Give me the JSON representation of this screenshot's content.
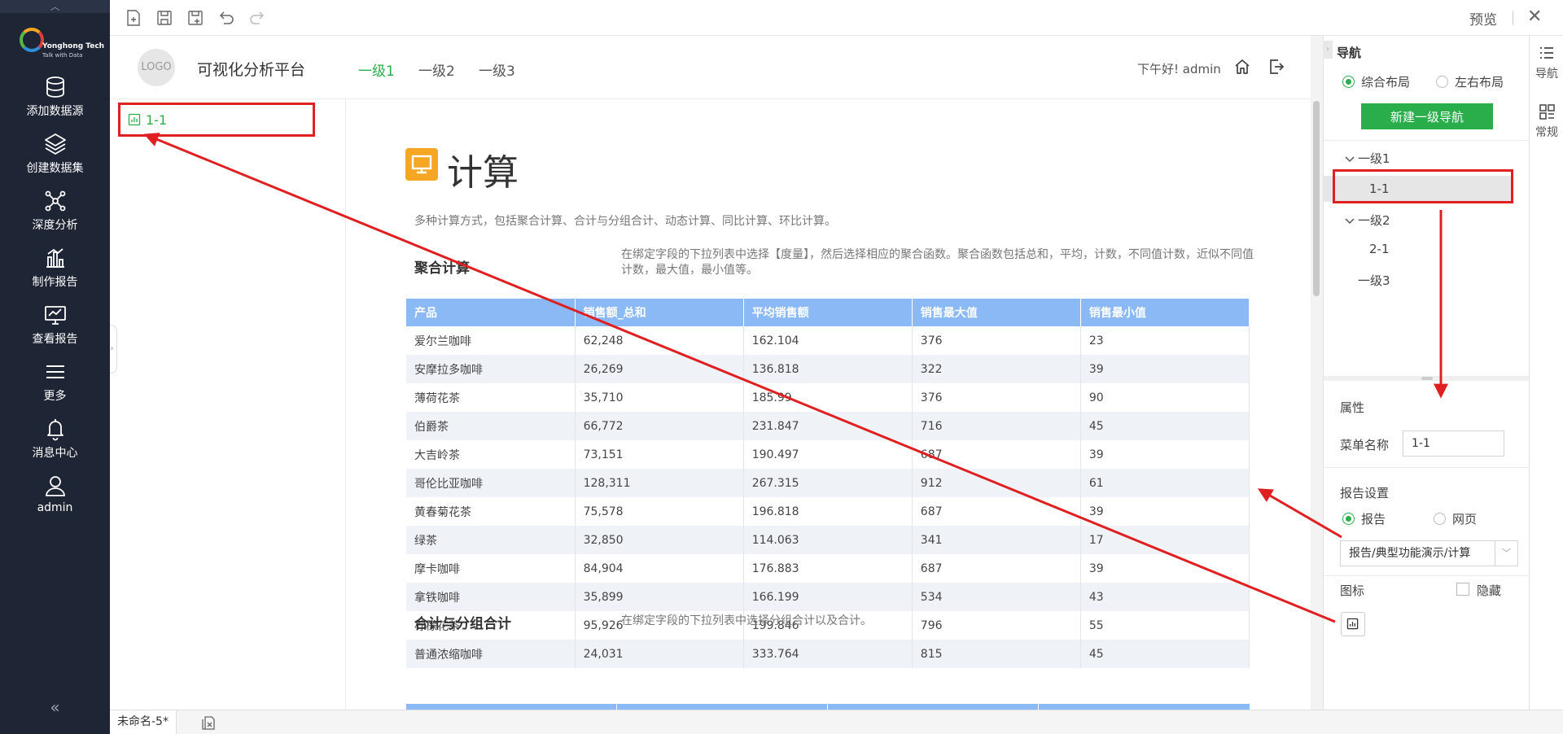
{
  "sidebar": {
    "brand": {
      "name": "Yonghong Tech",
      "slogan": "Talk with Data"
    },
    "items": [
      {
        "label": "添加数据源",
        "icon": "database-icon"
      },
      {
        "label": "创建数据集",
        "icon": "layers-icon"
      },
      {
        "label": "深度分析",
        "icon": "network-icon"
      },
      {
        "label": "制作报告",
        "icon": "bar-chart-icon"
      },
      {
        "label": "查看报告",
        "icon": "monitor-chart-icon"
      },
      {
        "label": "更多",
        "icon": "menu-icon"
      },
      {
        "label": "消息中心",
        "icon": "bell-icon"
      },
      {
        "label": "admin",
        "icon": "user-icon"
      }
    ]
  },
  "toolbar": {
    "preview_label": "预览",
    "close_label": "✕"
  },
  "app_header": {
    "logo_text": "LOGO",
    "title": "可视化分析平台",
    "nav": [
      "一级1",
      "一级2",
      "一级3"
    ],
    "active_nav": "一级1",
    "greeting": "下午好! admin"
  },
  "left_menu": {
    "item": "1-1"
  },
  "report": {
    "title": "计算",
    "description": "多种计算方式，包括聚合计算、合计与分组合计、动态计算、同比计算、环比计算。",
    "section1": {
      "title": "聚合计算",
      "description": "在绑定字段的下拉列表中选择【度量】，然后选择相应的聚合函数。聚合函数包括总和，平均，计数，不同值计数，近似不同值计数，最大值，最小值等。"
    },
    "table": {
      "headers": [
        "产品",
        "销售额_总和",
        "平均销售额",
        "销售最大值",
        "销售最小值"
      ],
      "rows": [
        [
          "爱尔兰咖啡",
          "62,248",
          "162.104",
          "376",
          "23"
        ],
        [
          "安摩拉多咖啡",
          "26,269",
          "136.818",
          "322",
          "39"
        ],
        [
          "薄荷花茶",
          "35,710",
          "185.99",
          "376",
          "90"
        ],
        [
          "伯爵茶",
          "66,772",
          "231.847",
          "716",
          "45"
        ],
        [
          "大吉岭茶",
          "73,151",
          "190.497",
          "687",
          "39"
        ],
        [
          "哥伦比亚咖啡",
          "128,311",
          "267.315",
          "912",
          "61"
        ],
        [
          "黄春菊花茶",
          "75,578",
          "196.818",
          "687",
          "39"
        ],
        [
          "绿茶",
          "32,850",
          "114.063",
          "341",
          "17"
        ],
        [
          "摩卡咖啡",
          "84,904",
          "176.883",
          "687",
          "39"
        ],
        [
          "拿铁咖啡",
          "35,899",
          "166.199",
          "534",
          "43"
        ],
        [
          "柠檬花茶",
          "95,926",
          "199.846",
          "796",
          "55"
        ],
        [
          "普通浓缩咖啡",
          "24,031",
          "333.764",
          "815",
          "45"
        ]
      ]
    },
    "section2": {
      "title": "合计与分组合计",
      "description": "在绑定字段的下拉列表中选择分组合计以及合计。"
    }
  },
  "bottom_tab": {
    "label": "未命名-5*"
  },
  "right_panel": {
    "nav_title": "导航",
    "layout_options": [
      "综合布局",
      "左右布局"
    ],
    "layout_selected": "综合布局",
    "new_button": "新建一级导航",
    "tree": [
      {
        "label": "一级1",
        "children": [
          "1-1"
        ]
      },
      {
        "label": "一级2",
        "children": [
          "2-1"
        ]
      },
      {
        "label": "一级3",
        "children": []
      }
    ],
    "selected_node": "1-1",
    "properties_title": "属性",
    "menu_name_label": "菜单名称",
    "menu_name_value": "1-1",
    "report_settings_title": "报告设置",
    "report_options": [
      "报告",
      "网页"
    ],
    "report_selected": "报告",
    "report_path": "报告/典型功能演示/计算",
    "icon_label": "图标",
    "hide_label": "隐藏"
  },
  "right_tabs": [
    {
      "label": "导航",
      "icon": "list-icon"
    },
    {
      "label": "常规",
      "icon": "grid-icon"
    }
  ],
  "colors": {
    "accent": "#2aad4b",
    "sidebar_bg": "#1e2535",
    "table_header": "#8ab9f5",
    "annotation": "#e02020"
  }
}
